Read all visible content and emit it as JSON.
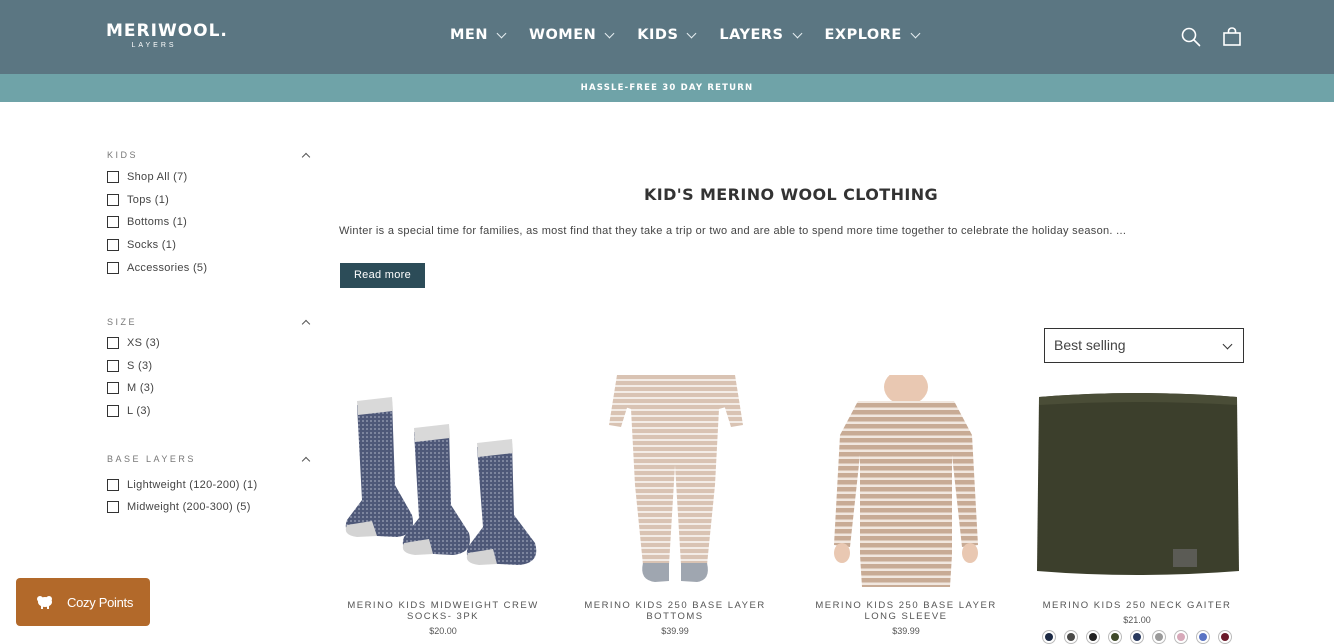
{
  "header": {
    "logo_main": "MERIWOOL.",
    "logo_sub": "LAYERS",
    "nav": [
      {
        "label": "MEN"
      },
      {
        "label": "WOMEN"
      },
      {
        "label": "KIDS"
      },
      {
        "label": "LAYERS"
      },
      {
        "label": "EXPLORE"
      }
    ],
    "icons": [
      "search-icon",
      "cart-icon"
    ]
  },
  "announcement": "HASSLE-FREE 30 DAY RETURN",
  "filters": [
    {
      "title": "KIDS",
      "options": [
        "Shop All (7)",
        "Tops (1)",
        "Bottoms (1)",
        "Socks (1)",
        "Accessories (5)"
      ]
    },
    {
      "title": "SIZE",
      "options": [
        "XS (3)",
        "S (3)",
        "M (3)",
        "L (3)"
      ]
    },
    {
      "title": "BASE LAYERS",
      "options": [
        "Lightweight (120-200) (1)",
        "Midweight (200-300) (5)"
      ]
    }
  ],
  "collection": {
    "title": "KID'S MERINO WOOL CLOTHING",
    "description": "Winter is a special time for families, as most find that they take a trip or two and are able to spend more time together to celebrate the holiday season. ...",
    "read_more": "Read more"
  },
  "sort": {
    "selected": "Best selling"
  },
  "products": [
    {
      "name_line1": "MERINO KIDS MIDWEIGHT CREW",
      "name_line2": "SOCKS- 3PK",
      "price": "$20.00",
      "swatches": []
    },
    {
      "name_line1": "MERINO KIDS 250 BASE LAYER",
      "name_line2": "BOTTOMS",
      "price": "$39.99",
      "swatches": []
    },
    {
      "name_line1": "MERINO KIDS 250 BASE LAYER",
      "name_line2": "LONG SLEEVE",
      "price": "$39.99",
      "swatches": []
    },
    {
      "name_line1": "MERINO KIDS 250 NECK GAITER",
      "name_line2": "",
      "price": "$21.00",
      "swatches": [
        "#1d2a44",
        "#4a4a48",
        "#222222",
        "#3f4a2a",
        "#2a3a5e",
        "#9a9a9a",
        "#d7a9b9",
        "#5a74c4",
        "#6b1a2a"
      ]
    }
  ],
  "cozy": {
    "label": "Cozy Points"
  },
  "colors": {
    "header_bg": "#5b7682",
    "announce_bg": "#6fa3a8",
    "button_bg": "#2c4c58",
    "cozy_bg": "#b2692a"
  }
}
